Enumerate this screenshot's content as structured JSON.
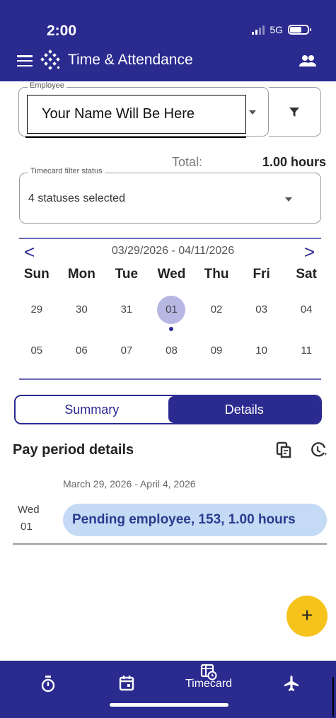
{
  "status_bar": {
    "time": "2:00",
    "network": "5G"
  },
  "header": {
    "title": "Time & Attendance"
  },
  "employee": {
    "legend": "Employee",
    "name": "Your Name Will Be Here"
  },
  "total": {
    "label": "Total:",
    "value": "1.00 hours"
  },
  "timecard_filter": {
    "legend": "Timecard filter status",
    "value": "4 statuses selected"
  },
  "calendar": {
    "range": "03/29/2026 - 04/11/2026",
    "prev": "<",
    "next": ">",
    "weekdays": [
      "Sun",
      "Mon",
      "Tue",
      "Wed",
      "Thu",
      "Fri",
      "Sat"
    ],
    "weeks": [
      [
        "29",
        "30",
        "31",
        "01",
        "02",
        "03",
        "04"
      ],
      [
        "05",
        "06",
        "07",
        "08",
        "09",
        "10",
        "11"
      ]
    ],
    "selected_day": "01"
  },
  "tabs": {
    "summary": "Summary",
    "details": "Details",
    "active": "Details"
  },
  "pay_period": {
    "title": "Pay period details",
    "range": "March 29, 2026 - April 4, 2026",
    "entries": [
      {
        "dow": "Wed",
        "day": "01",
        "text": "Pending employee, 153, 1.00 hours"
      }
    ]
  },
  "fab": {
    "label": "+"
  },
  "bottom_nav": {
    "timecard_label": "Timecard",
    "active": "Timecard"
  },
  "colors": {
    "brand": "#2b2a8f",
    "pill": "#c5daf4",
    "fab": "#f6c21c",
    "selected_day": "#b7b7e4"
  }
}
